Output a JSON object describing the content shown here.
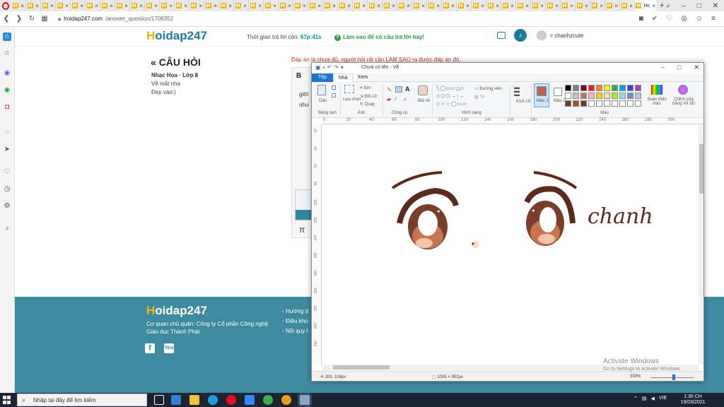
{
  "browser": {
    "tab_count": 43,
    "active_tab_title": "Hc",
    "new_tab_label": "+",
    "url_host": "hoidap247.com",
    "url_path": "/answer_question/1706352"
  },
  "header": {
    "logo": "Hoidap247",
    "timer_label": "Thời gian trả lời còn:",
    "timer_value": "67p:41s",
    "howto_text": "Làm sao để có câu trả lời hay!",
    "username": "chanhzcute"
  },
  "question": {
    "title": "CÂU HỎI",
    "subject": "Nhạc Họa · Lớp 8",
    "line1": "Vẽ mắt nha",
    "line2": "Đẹp vào:)"
  },
  "answer": {
    "note": "Đáp án là chưa đủ, người hỏi rất cần LÀM SAO ra được đáp án đó.",
    "bold_btn": "B",
    "text1": "giời",
    "text2": "như",
    "pi": "π"
  },
  "footer": {
    "logo": "Hoidap247",
    "owner_line1": "Cơ quan chủ quản: Công ty Cổ phần Công nghệ",
    "owner_line2": "Giáo dục Thành Phát",
    "links": [
      "Hướng d",
      "Điều kho",
      "Nội quy l"
    ]
  },
  "paint": {
    "title": "Chưa có tên - Vẽ",
    "tabs": [
      "Tệp",
      "Nhà",
      "Xem"
    ],
    "groups": [
      "Bảng tạm",
      "Ảnh",
      "Công cụ",
      "Hình dạng",
      "Màu"
    ],
    "ribbon": {
      "paste": "Dán",
      "select": "Lựa chọn",
      "crop": "Xén",
      "resize": "Đổi cỡ",
      "rotate": "Quay",
      "brushes": "Bút vẽ",
      "outline": "Đường viền",
      "fill": "Tô",
      "size": "Kích cỡ",
      "color1": "Màu 1",
      "color2": "Màu 2",
      "edit_colors": "Soạn thảo màu",
      "paint3d": "Chỉnh sửa bằng Vẽ 3D"
    },
    "ruler_h": [
      "0",
      "20",
      "40",
      "60",
      "80",
      "100",
      "120",
      "140",
      "160",
      "180",
      "200",
      "220",
      "240",
      "260",
      "280",
      "300"
    ],
    "ruler_v": [
      "20",
      "40",
      "60",
      "80",
      "100",
      "120",
      "140",
      "160",
      "180",
      "200",
      "220",
      "240",
      "260"
    ],
    "canvas_text": "chanh",
    "status_coords": "200, 106px",
    "status_size": "1095 × 952px",
    "status_zoom": "300%",
    "colors": {
      "color1": "#b5655a",
      "color2": "#ffffff",
      "palette": [
        "#000000",
        "#7f7f7f",
        "#880015",
        "#ed1c24",
        "#ff7f27",
        "#fff200",
        "#22b14c",
        "#00a2e8",
        "#3f48cc",
        "#a349a4",
        "#ffffff",
        "#c3c3c3",
        "#b97a57",
        "#ffaec9",
        "#ffc90e",
        "#efe4b0",
        "#b5e61d",
        "#99d9ea",
        "#7092be",
        "#c8bfe7",
        "#6b3a2a",
        "#a0522d",
        "#6b3a2a",
        "#ffffff",
        "#ffffff",
        "#ffffff",
        "#ffffff",
        "#ffffff",
        "#ffffff",
        "#ffffff"
      ]
    }
  },
  "watermark": {
    "line1": "Activate Windows",
    "line2": "Go to Settings to activate Windows."
  },
  "taskbar": {
    "search_placeholder": "Nhập tại đây để tìm kiếm",
    "tray": "VIE",
    "time": "1:30 CH",
    "date": "19/03/2021"
  }
}
